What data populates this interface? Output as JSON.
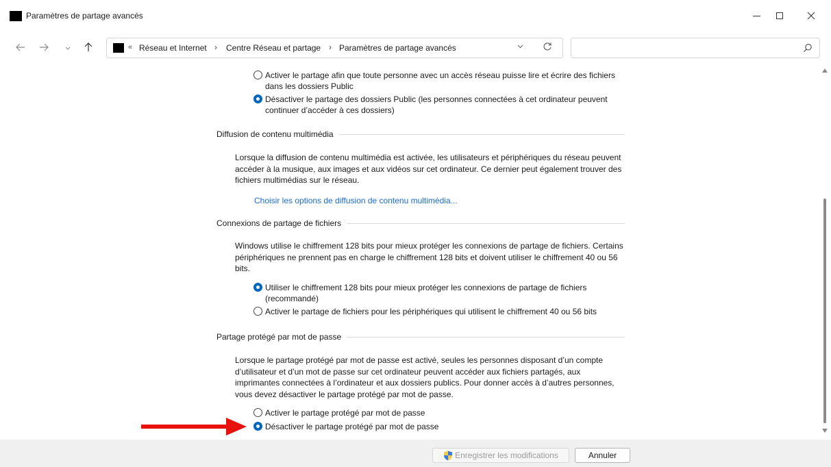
{
  "window": {
    "title": "Paramètres de partage avancés"
  },
  "address": {
    "overflow": "«",
    "crumbs": [
      "Réseau et Internet",
      "Centre Réseau et partage",
      "Paramètres de partage avancés"
    ],
    "separator": "›"
  },
  "search": {
    "placeholder": ""
  },
  "public_folders": {
    "option_enable": "Activer le partage afin que toute personne avec un accès réseau puisse lire et écrire des fichiers dans les dossiers Public",
    "option_disable": "Désactiver le partage des dossiers Public (les personnes connectées à cet ordinateur peuvent continuer d’accéder à ces dossiers)",
    "selected": "disable"
  },
  "media_streaming": {
    "title": "Diffusion de contenu multimédia",
    "description": "Lorsque la diffusion de contenu multimédia est activée, les utilisateurs et périphériques du réseau peuvent accéder à la musique, aux images et aux vidéos sur cet ordinateur. Ce dernier peut également trouver des fichiers multimédias sur le réseau.",
    "link": "Choisir les options de diffusion de contenu multimédia..."
  },
  "file_sharing": {
    "title": "Connexions de partage de fichiers",
    "description": "Windows utilise le chiffrement 128 bits pour mieux protéger les connexions de partage de fichiers. Certains périphériques ne prennent pas en charge le chiffrement 128 bits et doivent utiliser le chiffrement 40 ou 56 bits.",
    "option_128": "Utiliser le chiffrement 128 bits pour mieux protéger les connexions de partage de fichiers (recommandé)",
    "option_40_56": "Activer le partage de fichiers pour les périphériques qui utilisent le chiffrement 40 ou 56 bits",
    "selected": "128"
  },
  "password_sharing": {
    "title": "Partage protégé par mot de passe",
    "description": "Lorsque le partage protégé par mot de passe est activé, seules les personnes disposant d’un compte d’utilisateur et d’un mot de passe sur cet ordinateur peuvent accéder aux fichiers partagés, aux imprimantes connectées à l’ordinateur et aux dossiers publics. Pour donner accès à d’autres personnes, vous devez désactiver le partage protégé par mot de passe.",
    "option_enable": "Activer le partage protégé par mot de passe",
    "option_disable": "Désactiver le partage protégé par mot de passe",
    "selected": "disable"
  },
  "buttons": {
    "save": "Enregistrer les modifications",
    "cancel": "Annuler"
  },
  "colors": {
    "accent": "#0067c0",
    "link": "#1a6bd0",
    "arrow": "#e8120c"
  }
}
